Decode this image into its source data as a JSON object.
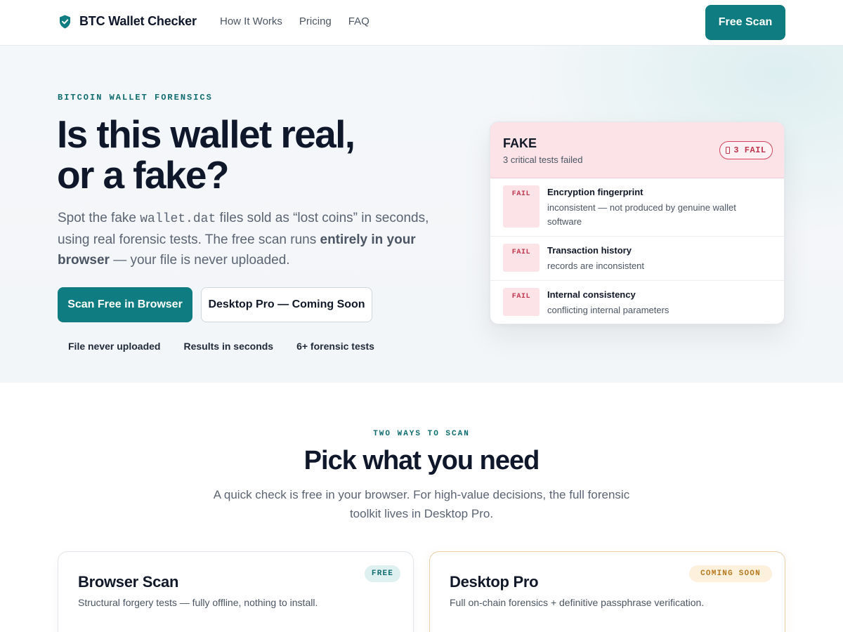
{
  "nav": {
    "brand": "BTC Wallet Checker",
    "links": [
      "How It Works",
      "Pricing",
      "FAQ"
    ],
    "cta": "Free Scan"
  },
  "hero": {
    "eyebrow": "BITCOIN WALLET FORENSICS",
    "title_line1": "Is this wallet real,",
    "title_line2": "or a fake?",
    "sub_part1": "Spot the fake ",
    "sub_code": "wallet.dat",
    "sub_part2": " files sold as “lost coins” in seconds, using real forensic tests. The free scan runs ",
    "sub_bold": "entirely in your browser",
    "sub_part3": " — your file is never uploaded.",
    "primary_button": "Scan Free in Browser",
    "secondary_button": "Desktop Pro — Coming Soon",
    "features": [
      "File never uploaded",
      "Results in seconds",
      "6+ forensic tests"
    ]
  },
  "result": {
    "verdict": "FAKE",
    "verdict_sub": "3 critical tests failed",
    "pill": "3 FAIL",
    "tests": [
      {
        "tag": "FAIL",
        "title": "Encryption fingerprint",
        "desc": "inconsistent — not produced by genuine wallet software"
      },
      {
        "tag": "FAIL",
        "title": "Transaction history",
        "desc": "records are inconsistent"
      },
      {
        "tag": "FAIL",
        "title": "Internal consistency",
        "desc": "conflicting internal parameters"
      }
    ]
  },
  "section": {
    "eyebrow": "TWO WAYS TO SCAN",
    "title": "Pick what you need",
    "sub": "A quick check is free in your browser. For high-value decisions, the full forensic toolkit lives in Desktop Pro."
  },
  "plans": [
    {
      "name": "Browser Scan",
      "desc": "Structural forgery tests — fully offline, nothing to install.",
      "badge": "FREE"
    },
    {
      "name": "Desktop Pro",
      "desc": "Full on-chain forensics + definitive passphrase verification.",
      "badge": "COMING SOON"
    }
  ],
  "colors": {
    "accent": "#0e7c80",
    "fail": "#c0364e",
    "fail_bg": "#fbe3e7",
    "soon": "#b7791f"
  },
  "icons": {
    "brand": "shield-check-icon",
    "pill": "alert-icon"
  }
}
